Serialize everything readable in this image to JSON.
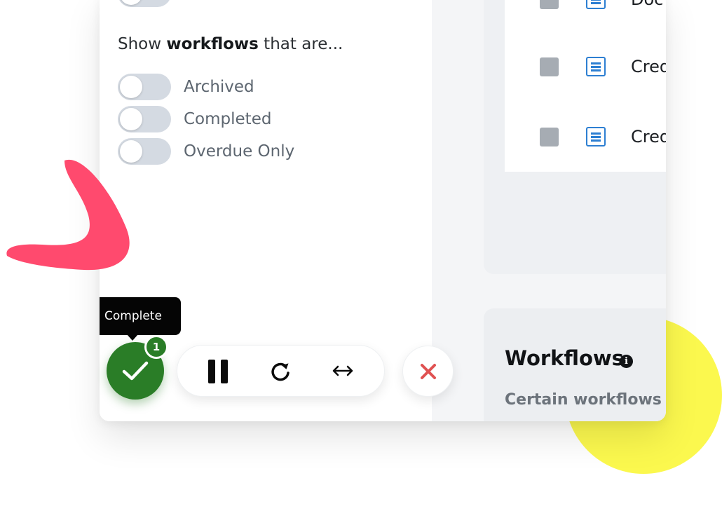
{
  "filters": {
    "heading_prefix": "Show ",
    "heading_bold": "workflows",
    "heading_suffix": " that are...",
    "toggles": [
      {
        "label": "Archived",
        "on": false
      },
      {
        "label": "Completed",
        "on": false
      },
      {
        "label": "Overdue Only",
        "on": false
      }
    ]
  },
  "list": {
    "rows": [
      {
        "text": "Doc"
      },
      {
        "text": "Cred"
      },
      {
        "text": "Cred"
      }
    ]
  },
  "workflows_card": {
    "title": "Workflows",
    "info_icon": "i",
    "subtitle": "Certain workflows"
  },
  "toolbar": {
    "tooltip": "Complete",
    "complete_badge_count": "1",
    "icons": [
      "check-icon",
      "pause-icon",
      "refresh-icon",
      "resize-horizontal-icon",
      "close-icon"
    ]
  },
  "colors": {
    "complete_green": "#2a7d27",
    "close_red": "#e05252",
    "doc_blue": "#2d7fd2",
    "accent_yellow": "#fbf84e",
    "accent_pink": "#ff4a6e"
  }
}
